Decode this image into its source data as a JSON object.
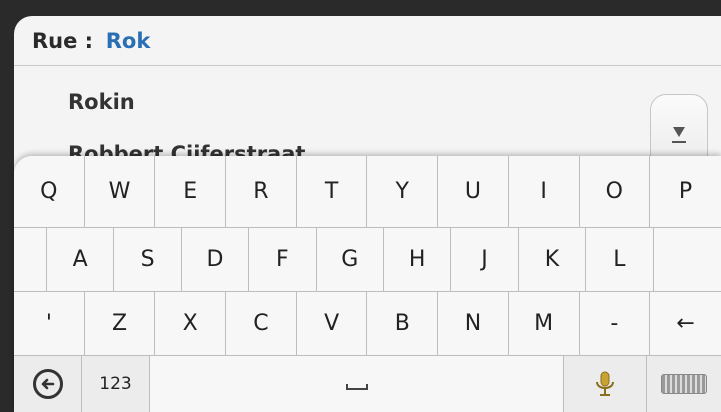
{
  "search": {
    "label": "Rue :",
    "value": "Rok"
  },
  "results": [
    "Rokin",
    "Robbert Ciiferstraat"
  ],
  "scroll_icon": "chevron-down-bar-icon",
  "keyboard": {
    "row1": [
      "Q",
      "W",
      "E",
      "R",
      "T",
      "Y",
      "U",
      "I",
      "O",
      "P"
    ],
    "row2": [
      "A",
      "S",
      "D",
      "F",
      "G",
      "H",
      "J",
      "K",
      "L"
    ],
    "row3": [
      "'",
      "Z",
      "X",
      "C",
      "V",
      "B",
      "N",
      "M",
      "-",
      "←"
    ],
    "row4": {
      "undo_icon": "undo-icon",
      "numbers": "123",
      "space_icon": "space-icon",
      "mic_icon": "microphone-icon",
      "kbd_icon": "keyboard-icon"
    }
  }
}
